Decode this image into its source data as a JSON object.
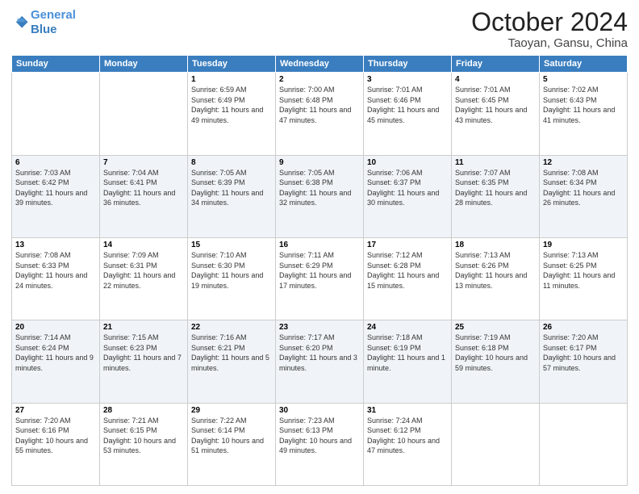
{
  "header": {
    "logo_line1": "General",
    "logo_line2": "Blue",
    "month": "October 2024",
    "location": "Taoyan, Gansu, China"
  },
  "days_of_week": [
    "Sunday",
    "Monday",
    "Tuesday",
    "Wednesday",
    "Thursday",
    "Friday",
    "Saturday"
  ],
  "weeks": [
    [
      {
        "day": "",
        "info": ""
      },
      {
        "day": "",
        "info": ""
      },
      {
        "day": "1",
        "info": "Sunrise: 6:59 AM\nSunset: 6:49 PM\nDaylight: 11 hours and 49 minutes."
      },
      {
        "day": "2",
        "info": "Sunrise: 7:00 AM\nSunset: 6:48 PM\nDaylight: 11 hours and 47 minutes."
      },
      {
        "day": "3",
        "info": "Sunrise: 7:01 AM\nSunset: 6:46 PM\nDaylight: 11 hours and 45 minutes."
      },
      {
        "day": "4",
        "info": "Sunrise: 7:01 AM\nSunset: 6:45 PM\nDaylight: 11 hours and 43 minutes."
      },
      {
        "day": "5",
        "info": "Sunrise: 7:02 AM\nSunset: 6:43 PM\nDaylight: 11 hours and 41 minutes."
      }
    ],
    [
      {
        "day": "6",
        "info": "Sunrise: 7:03 AM\nSunset: 6:42 PM\nDaylight: 11 hours and 39 minutes."
      },
      {
        "day": "7",
        "info": "Sunrise: 7:04 AM\nSunset: 6:41 PM\nDaylight: 11 hours and 36 minutes."
      },
      {
        "day": "8",
        "info": "Sunrise: 7:05 AM\nSunset: 6:39 PM\nDaylight: 11 hours and 34 minutes."
      },
      {
        "day": "9",
        "info": "Sunrise: 7:05 AM\nSunset: 6:38 PM\nDaylight: 11 hours and 32 minutes."
      },
      {
        "day": "10",
        "info": "Sunrise: 7:06 AM\nSunset: 6:37 PM\nDaylight: 11 hours and 30 minutes."
      },
      {
        "day": "11",
        "info": "Sunrise: 7:07 AM\nSunset: 6:35 PM\nDaylight: 11 hours and 28 minutes."
      },
      {
        "day": "12",
        "info": "Sunrise: 7:08 AM\nSunset: 6:34 PM\nDaylight: 11 hours and 26 minutes."
      }
    ],
    [
      {
        "day": "13",
        "info": "Sunrise: 7:08 AM\nSunset: 6:33 PM\nDaylight: 11 hours and 24 minutes."
      },
      {
        "day": "14",
        "info": "Sunrise: 7:09 AM\nSunset: 6:31 PM\nDaylight: 11 hours and 22 minutes."
      },
      {
        "day": "15",
        "info": "Sunrise: 7:10 AM\nSunset: 6:30 PM\nDaylight: 11 hours and 19 minutes."
      },
      {
        "day": "16",
        "info": "Sunrise: 7:11 AM\nSunset: 6:29 PM\nDaylight: 11 hours and 17 minutes."
      },
      {
        "day": "17",
        "info": "Sunrise: 7:12 AM\nSunset: 6:28 PM\nDaylight: 11 hours and 15 minutes."
      },
      {
        "day": "18",
        "info": "Sunrise: 7:13 AM\nSunset: 6:26 PM\nDaylight: 11 hours and 13 minutes."
      },
      {
        "day": "19",
        "info": "Sunrise: 7:13 AM\nSunset: 6:25 PM\nDaylight: 11 hours and 11 minutes."
      }
    ],
    [
      {
        "day": "20",
        "info": "Sunrise: 7:14 AM\nSunset: 6:24 PM\nDaylight: 11 hours and 9 minutes."
      },
      {
        "day": "21",
        "info": "Sunrise: 7:15 AM\nSunset: 6:23 PM\nDaylight: 11 hours and 7 minutes."
      },
      {
        "day": "22",
        "info": "Sunrise: 7:16 AM\nSunset: 6:21 PM\nDaylight: 11 hours and 5 minutes."
      },
      {
        "day": "23",
        "info": "Sunrise: 7:17 AM\nSunset: 6:20 PM\nDaylight: 11 hours and 3 minutes."
      },
      {
        "day": "24",
        "info": "Sunrise: 7:18 AM\nSunset: 6:19 PM\nDaylight: 11 hours and 1 minute."
      },
      {
        "day": "25",
        "info": "Sunrise: 7:19 AM\nSunset: 6:18 PM\nDaylight: 10 hours and 59 minutes."
      },
      {
        "day": "26",
        "info": "Sunrise: 7:20 AM\nSunset: 6:17 PM\nDaylight: 10 hours and 57 minutes."
      }
    ],
    [
      {
        "day": "27",
        "info": "Sunrise: 7:20 AM\nSunset: 6:16 PM\nDaylight: 10 hours and 55 minutes."
      },
      {
        "day": "28",
        "info": "Sunrise: 7:21 AM\nSunset: 6:15 PM\nDaylight: 10 hours and 53 minutes."
      },
      {
        "day": "29",
        "info": "Sunrise: 7:22 AM\nSunset: 6:14 PM\nDaylight: 10 hours and 51 minutes."
      },
      {
        "day": "30",
        "info": "Sunrise: 7:23 AM\nSunset: 6:13 PM\nDaylight: 10 hours and 49 minutes."
      },
      {
        "day": "31",
        "info": "Sunrise: 7:24 AM\nSunset: 6:12 PM\nDaylight: 10 hours and 47 minutes."
      },
      {
        "day": "",
        "info": ""
      },
      {
        "day": "",
        "info": ""
      }
    ]
  ]
}
